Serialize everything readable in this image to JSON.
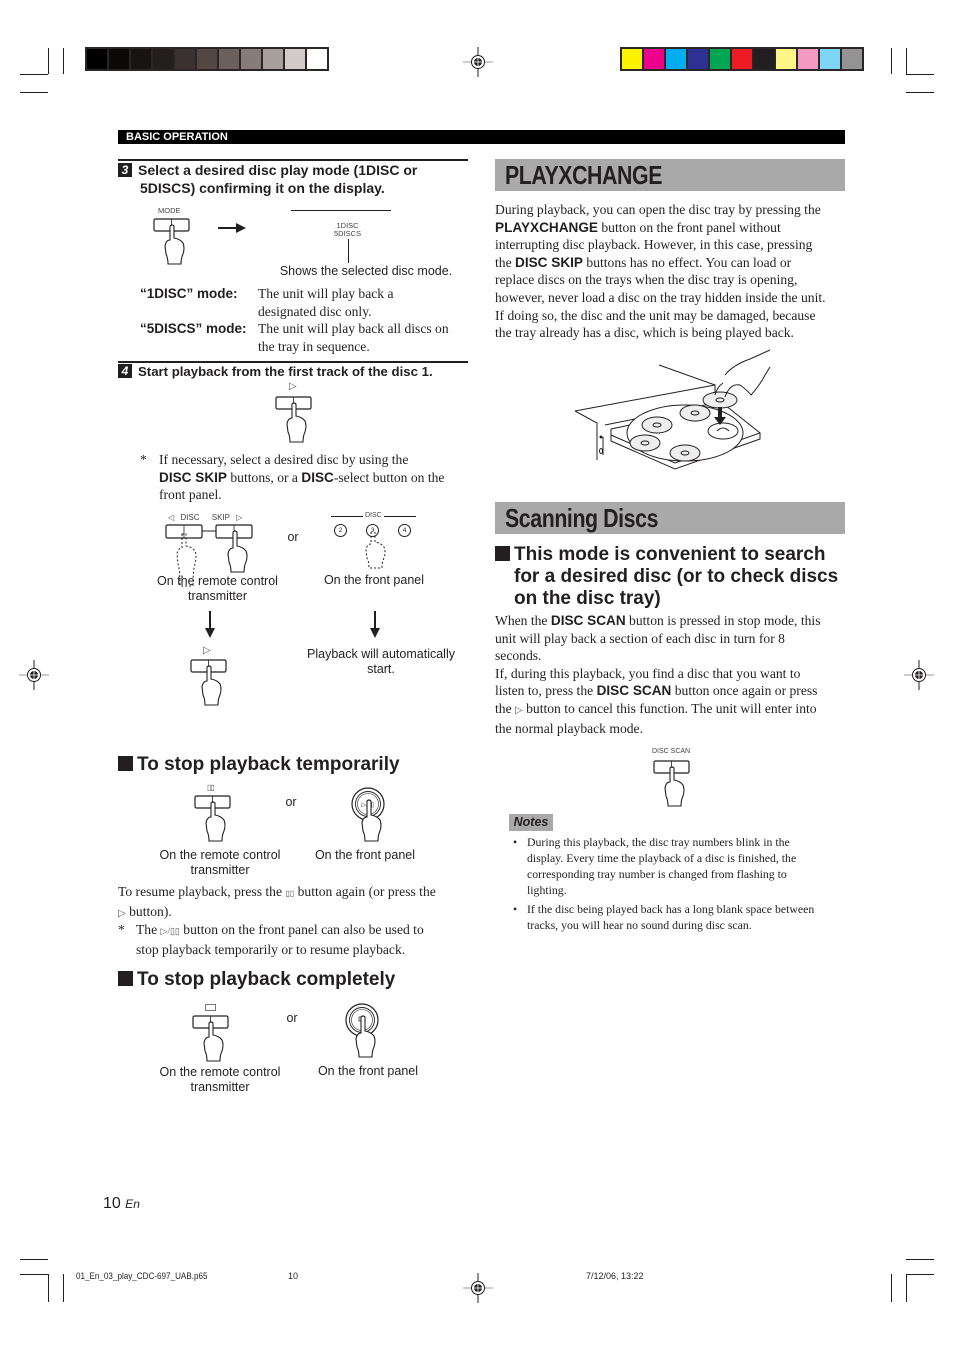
{
  "print_marks": {
    "grayscale_swatches": [
      "#000000",
      "#0c0a09",
      "#181413",
      "#231f1e",
      "#3a3130",
      "#544845",
      "#6c605d",
      "#877c79",
      "#a89f9d",
      "#d3cbca",
      "#ffffff"
    ],
    "color_swatches": [
      "#fff200",
      "#ec008c",
      "#00aeef",
      "#2e3192",
      "#00a651",
      "#ed1c24",
      "#231f20",
      "#fff685",
      "#f49ac2",
      "#7dd6f6",
      "#939393"
    ]
  },
  "header": {
    "section_label": "BASIC OPERATION"
  },
  "left": {
    "step3": {
      "number": "3",
      "title_line1": "Select a desired disc play mode (1DISC or",
      "title_line2": "5DISCS) confirming it on the display.",
      "button_label": "MODE",
      "display_line1": "1DISC",
      "display_line2": "5DISCS",
      "display_caption": "Shows the selected disc mode.",
      "modes": [
        {
          "label": "“1DISC” mode:",
          "desc_line1": "The unit will play back a",
          "desc_line2": "designated disc only."
        },
        {
          "label": "“5DISCS” mode:",
          "desc_line1": "The unit will play back all discs on",
          "desc_line2": "the tray in sequence."
        }
      ]
    },
    "step4": {
      "number": "4",
      "title": "Start playback from the first track of the disc 1.",
      "play_symbol": "▷",
      "note_star": "*",
      "note_line1": "If necessary, select a desired disc by using the",
      "note_l2_bold1": "DISC SKIP",
      "note_l2_mid": " buttons, or a ",
      "note_l2_bold2": "DISC",
      "note_l2_end": "-select button on the",
      "note_line3": "front panel.",
      "remote_labels": {
        "prev": "◁",
        "disc": "DISC",
        "skip": "SKIP",
        "next": "▷"
      },
      "or_label": "or",
      "front_disc_label": "DISC",
      "front_discs": [
        "2",
        "3",
        "4"
      ],
      "caption_remote_l1": "On the remote control",
      "caption_remote_l2": "transmitter",
      "caption_front": "On the front panel",
      "auto_start_l1": "Playback will automatically",
      "auto_start_l2": "start."
    },
    "stop_temp": {
      "title": "To stop playback temporarily",
      "pause_symbol": "▯▯",
      "front_button_label": "▷/▯▯",
      "or_label": "or",
      "caption_remote_l1": "On the remote control",
      "caption_remote_l2": "transmitter",
      "caption_front": "On the front panel",
      "resume_l1a": "To resume playback, press the ",
      "resume_l1b": " button again (or press the",
      "resume_l2": " button).",
      "note_star": "*",
      "note_l1a": "The ",
      "note_l1b": " button on the front panel can also be used to",
      "note_l2": "stop playback temporarily or to resume playback."
    },
    "stop_full": {
      "title": "To stop playback completely",
      "or_label": "or",
      "caption_remote_l1": "On the remote control",
      "caption_remote_l2": "transmitter",
      "caption_front": "On the front panel"
    }
  },
  "right": {
    "playxchange": {
      "title": "PLAYXCHANGE",
      "p_l1": "During playback, you can open the disc tray by pressing the",
      "p_l2_bold": "PLAYXCHANGE",
      "p_l2_end": " button on the front panel without",
      "p_l3": "interrupting disc playback. However, in this case, pressing",
      "p_l4_start": "the ",
      "p_l4_bold": "DISC SKIP",
      "p_l4_end": " buttons has no effect. You can load or",
      "p_l5": "replace discs on the trays when the disc tray is opening,",
      "p_l6": "however, never load a disc on the tray hidden inside the unit.",
      "p_l7": "If doing so, the disc and the unit may be damaged, because",
      "p_l8": "the tray already has a disc, which is being played back."
    },
    "scanning": {
      "title": "Scanning Discs",
      "sub_l1": "This mode is convenient to search",
      "sub_l2": "for a desired disc (or to check discs",
      "sub_l3": "on the disc tray)",
      "p1_l1_start": "When the ",
      "p1_l1_bold": "DISC SCAN",
      "p1_l1_end": " button is pressed in stop mode, this",
      "p1_l2": "unit will play back a section of each disc in turn for 8",
      "p1_l3": "seconds.",
      "p2_l1": "If, during this playback, you find a disc that you want to",
      "p2_l2_start": "listen to, press the ",
      "p2_l2_bold": "DISC SCAN",
      "p2_l2_end": " button once again or press",
      "p2_l3_start": "the ",
      "p2_l3_end": " button to cancel this function. The unit will enter into",
      "p2_l4": "the normal playback mode.",
      "button_label": "DISC SCAN",
      "notes_label": "Notes",
      "notes": [
        {
          "l1": "During this playback, the disc tray numbers blink in the",
          "l2": "display. Every time the playback of a disc is finished, the",
          "l3": "corresponding tray number is changed from flashing to",
          "l4": "lighting."
        },
        {
          "l1": "If the disc being played back has a long blank space between",
          "l2": "tracks, you will hear no sound during disc scan."
        }
      ]
    }
  },
  "footer": {
    "page_number": "10",
    "lang": "En",
    "file_name": "01_En_03_play_CDC-697_UAB.p65",
    "file_page": "10",
    "timestamp": "7/12/06, 13:22"
  }
}
